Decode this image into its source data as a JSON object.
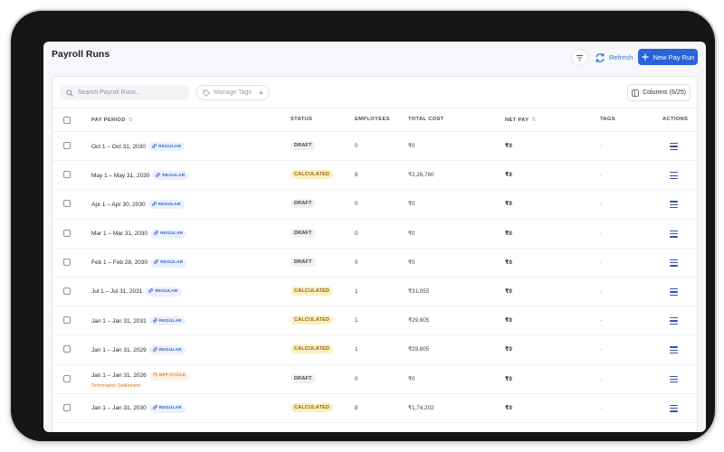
{
  "page": {
    "title": "Payroll Runs"
  },
  "toolbar": {
    "refresh_label": "Refresh",
    "new_label": "New Pay Run",
    "search_placeholder": "Search Payroll Runs...",
    "manage_tags_label": "Manage Tags",
    "columns_label": "Columns (6/25)"
  },
  "table": {
    "headers": {
      "pay_period": "PAY PERIOD",
      "status": "STATUS",
      "employees": "EMPLOYEES",
      "total_cost": "TOTAL COST",
      "net_pay": "NET PAY",
      "tags": "TAGS",
      "actions": "ACTIONS"
    },
    "rows": [
      {
        "period": "Oct 1 – Oct 31, 2030",
        "type": "REGULAR",
        "note": "",
        "status": "DRAFT",
        "employees": "0",
        "total_cost": "₹0",
        "net_pay": "₹0",
        "tags": "-"
      },
      {
        "period": "May 1 – May 31, 2030",
        "type": "REGULAR",
        "note": "",
        "status": "CALCULATED",
        "employees": "8",
        "total_cost": "₹2,26,760",
        "net_pay": "₹0",
        "tags": "-"
      },
      {
        "period": "Apr 1 – Apr 30, 2030",
        "type": "REGULAR",
        "note": "",
        "status": "DRAFT",
        "employees": "0",
        "total_cost": "₹0",
        "net_pay": "₹0",
        "tags": "-"
      },
      {
        "period": "Mar 1 – Mar 31, 2030",
        "type": "REGULAR",
        "note": "",
        "status": "DRAFT",
        "employees": "0",
        "total_cost": "₹0",
        "net_pay": "₹0",
        "tags": "-"
      },
      {
        "period": "Feb 1 – Feb 28, 2030",
        "type": "REGULAR",
        "note": "",
        "status": "DRAFT",
        "employees": "0",
        "total_cost": "₹0",
        "net_pay": "₹0",
        "tags": "-"
      },
      {
        "period": "Jul 1 – Jul 31, 2031",
        "type": "REGULAR",
        "note": "",
        "status": "CALCULATED",
        "employees": "1",
        "total_cost": "₹31,055",
        "net_pay": "₹0",
        "tags": "-"
      },
      {
        "period": "Jan 1 – Jan 31, 2031",
        "type": "REGULAR",
        "note": "",
        "status": "CALCULATED",
        "employees": "1",
        "total_cost": "₹29,805",
        "net_pay": "₹0",
        "tags": "-"
      },
      {
        "period": "Jan 1 – Jan 31, 2029",
        "type": "REGULAR",
        "note": "",
        "status": "CALCULATED",
        "employees": "1",
        "total_cost": "₹29,805",
        "net_pay": "₹0",
        "tags": "-"
      },
      {
        "period": "Jan 1 – Jan 31, 2026",
        "type": "OFF-CYCLE",
        "note": "Termination Settlement",
        "status": "DRAFT",
        "employees": "0",
        "total_cost": "₹0",
        "net_pay": "₹0",
        "tags": "-"
      },
      {
        "period": "Jan 1 – Jan 31, 2030",
        "type": "REGULAR",
        "note": "",
        "status": "CALCULATED",
        "employees": "8",
        "total_cost": "₹1,74,202",
        "net_pay": "₹0",
        "tags": "-"
      }
    ]
  },
  "icons": {
    "filter": "filter-icon",
    "refresh": "refresh-icon",
    "new": "plus-icon",
    "search": "search-icon",
    "tag": "tag-icon",
    "columns": "columns-icon",
    "sort": "sort-icon",
    "actions": "menu-icon",
    "regular": "link-icon",
    "off_cycle": "cycle-icon"
  },
  "colors": {
    "accent": "#2c63d9",
    "refresh": "#3a6fd8",
    "draft_bg": "#eef0f3",
    "calculated_bg": "#fcf0c2",
    "calculated_text": "#8a6410",
    "regular_text": "#3b63c8",
    "off_cycle_text": "#d57a1b"
  }
}
